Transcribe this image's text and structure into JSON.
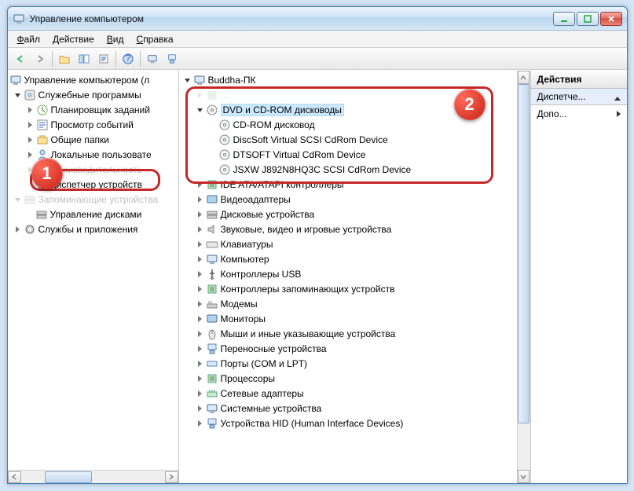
{
  "window": {
    "title": "Управление компьютером"
  },
  "menu": {
    "file": "Файл",
    "action": "Действие",
    "view": "Вид",
    "help": "Справка"
  },
  "leftTree": {
    "root": "Управление компьютером (л",
    "tools": "Служебные программы",
    "scheduler": "Планировщик заданий",
    "events": "Просмотр событий",
    "shared": "Общие папки",
    "users": "Локальные пользовате",
    "perf_trunc": "Производительность",
    "devmgr": "Диспетчер устройств",
    "storage_trunc": "Запоминающие устройства",
    "diskmgmt": "Управление дисками",
    "services": "Службы и приложения"
  },
  "centerTree": {
    "root": "Buddha-ПК",
    "cat_dvd": "DVD и CD-ROM дисководы",
    "dvd_items": [
      "CD-ROM дисковод",
      "DiscSoft Virtual SCSI CdRom Device",
      "DTSOFT Virtual CdRom Device",
      "JSXW J892N8HQ3C SCSI CdRom Device"
    ],
    "cat_ide": "IDE ATA/ATAPI контроллеры",
    "cat_video": "Видеоадаптеры",
    "cat_disk": "Дисковые устройства",
    "cat_sound": "Звуковые, видео и игровые устройства",
    "cat_keyboard": "Клавиатуры",
    "cat_computer": "Компьютер",
    "cat_usb": "Контроллеры USB",
    "cat_storagectl": "Контроллеры запоминающих устройств",
    "cat_modem": "Модемы",
    "cat_monitor": "Мониторы",
    "cat_mouse": "Мыши и иные указывающие устройства",
    "cat_portable": "Переносные устройства",
    "cat_ports": "Порты (COM и LPT)",
    "cat_cpu": "Процессоры",
    "cat_net": "Сетевые адаптеры",
    "cat_system": "Системные устройства",
    "cat_hid": "Устройства HID (Human Interface Devices)"
  },
  "actions": {
    "header": "Действия",
    "section": "Диспетче...",
    "more": "Допо..."
  },
  "badges": {
    "one": "1",
    "two": "2"
  }
}
